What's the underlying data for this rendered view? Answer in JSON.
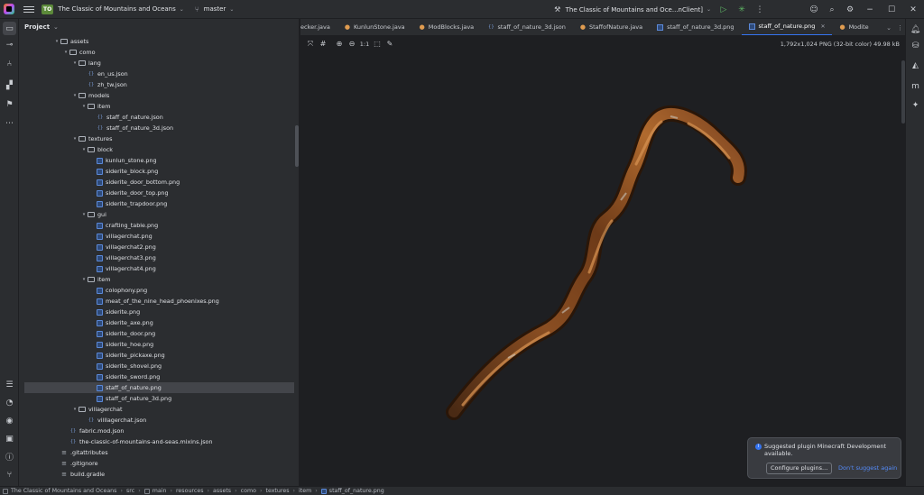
{
  "titlebar": {
    "project_badge": "TO",
    "project_name": "The Classic of Mountains and Oceans",
    "branch": "master",
    "run_config": "The Classic of Mountains and Oce...nClient]",
    "icons": [
      "run-icon",
      "debug-icon",
      "more-icon",
      "account-icon",
      "search-icon",
      "settings-icon",
      "minimize-icon",
      "maximize-icon",
      "close-icon"
    ]
  },
  "project_panel": {
    "title": "Project",
    "tree": [
      {
        "label": "assets",
        "type": "folder",
        "depth": 0,
        "expanded": true
      },
      {
        "label": "como",
        "type": "folder",
        "depth": 1,
        "expanded": true
      },
      {
        "label": "lang",
        "type": "folder",
        "depth": 2,
        "expanded": true
      },
      {
        "label": "en_us.json",
        "type": "json",
        "depth": 3
      },
      {
        "label": "zh_tw.json",
        "type": "json",
        "depth": 3
      },
      {
        "label": "models",
        "type": "folder",
        "depth": 2,
        "expanded": true
      },
      {
        "label": "item",
        "type": "folder",
        "depth": 3,
        "expanded": true
      },
      {
        "label": "staff_of_nature.json",
        "type": "json",
        "depth": 4
      },
      {
        "label": "staff_of_nature_3d.json",
        "type": "json",
        "depth": 4
      },
      {
        "label": "textures",
        "type": "folder",
        "depth": 2,
        "expanded": true
      },
      {
        "label": "block",
        "type": "folder",
        "depth": 3,
        "expanded": true
      },
      {
        "label": "kunlun_stone.png",
        "type": "png",
        "depth": 4
      },
      {
        "label": "siderite_block.png",
        "type": "png",
        "depth": 4
      },
      {
        "label": "siderite_door_bottom.png",
        "type": "png",
        "depth": 4
      },
      {
        "label": "siderite_door_top.png",
        "type": "png",
        "depth": 4
      },
      {
        "label": "siderite_trapdoor.png",
        "type": "png",
        "depth": 4
      },
      {
        "label": "gui",
        "type": "folder",
        "depth": 3,
        "expanded": true
      },
      {
        "label": "crafting_table.png",
        "type": "png",
        "depth": 4
      },
      {
        "label": "villagerchat.png",
        "type": "png",
        "depth": 4
      },
      {
        "label": "villagerchat2.png",
        "type": "png",
        "depth": 4
      },
      {
        "label": "villagerchat3.png",
        "type": "png",
        "depth": 4
      },
      {
        "label": "villagerchat4.png",
        "type": "png",
        "depth": 4
      },
      {
        "label": "item",
        "type": "folder",
        "depth": 3,
        "expanded": true
      },
      {
        "label": "colophony.png",
        "type": "png",
        "depth": 4
      },
      {
        "label": "meat_of_the_nine_head_phoenixes.png",
        "type": "png",
        "depth": 4
      },
      {
        "label": "siderite.png",
        "type": "png",
        "depth": 4
      },
      {
        "label": "siderite_axe.png",
        "type": "png",
        "depth": 4
      },
      {
        "label": "siderite_door.png",
        "type": "png",
        "depth": 4
      },
      {
        "label": "siderite_hoe.png",
        "type": "png",
        "depth": 4
      },
      {
        "label": "siderite_pickaxe.png",
        "type": "png",
        "depth": 4
      },
      {
        "label": "siderite_shovel.png",
        "type": "png",
        "depth": 4
      },
      {
        "label": "siderite_sword.png",
        "type": "png",
        "depth": 4
      },
      {
        "label": "staff_of_nature.png",
        "type": "png",
        "depth": 4,
        "selected": true
      },
      {
        "label": "staff_of_nature_3d.png",
        "type": "png",
        "depth": 4
      },
      {
        "label": "villagerchat",
        "type": "folder",
        "depth": 2,
        "expanded": true
      },
      {
        "label": "villlagerchat.json",
        "type": "json",
        "depth": 3
      },
      {
        "label": "fabric.mod.json",
        "type": "json",
        "depth": 1
      },
      {
        "label": "the-classic-of-mountains-and-seas.mixins.json",
        "type": "json",
        "depth": 1
      },
      {
        "label": ".gitattributes",
        "type": "file",
        "depth": 0
      },
      {
        "label": ".gitignore",
        "type": "file",
        "depth": 0
      },
      {
        "label": "build.gradle",
        "type": "file",
        "depth": 0
      }
    ]
  },
  "editor": {
    "tabs": [
      {
        "label": "ecker.java",
        "kind": "java"
      },
      {
        "label": "KunlunStone.java",
        "kind": "java"
      },
      {
        "label": "ModBlocks.java",
        "kind": "java"
      },
      {
        "label": "staff_of_nature_3d.json",
        "kind": "json"
      },
      {
        "label": "StaffofNature.java",
        "kind": "java"
      },
      {
        "label": "staff_of_nature_3d.png",
        "kind": "png"
      },
      {
        "label": "staff_of_nature.png",
        "kind": "png",
        "active": true
      },
      {
        "label": "Modite",
        "kind": "java"
      }
    ],
    "image_info": "1,792x1,024 PNG (32-bit color) 49.98 kB",
    "zoom_actual": "1:1"
  },
  "notification": {
    "message": "Suggested plugin Minecraft Development available.",
    "configure_label": "Configure plugins...",
    "dismiss_label": "Don't suggest again"
  },
  "statusbar": {
    "crumbs": [
      "The Classic of Mountains and Oceans",
      "src",
      "main",
      "resources",
      "assets",
      "como",
      "textures",
      "item",
      "staff_of_nature.png"
    ]
  },
  "colors": {
    "accent": "#3574f0",
    "panel_bg": "#2b2d30",
    "editor_bg": "#1e1f22",
    "selection": "#43454a"
  }
}
